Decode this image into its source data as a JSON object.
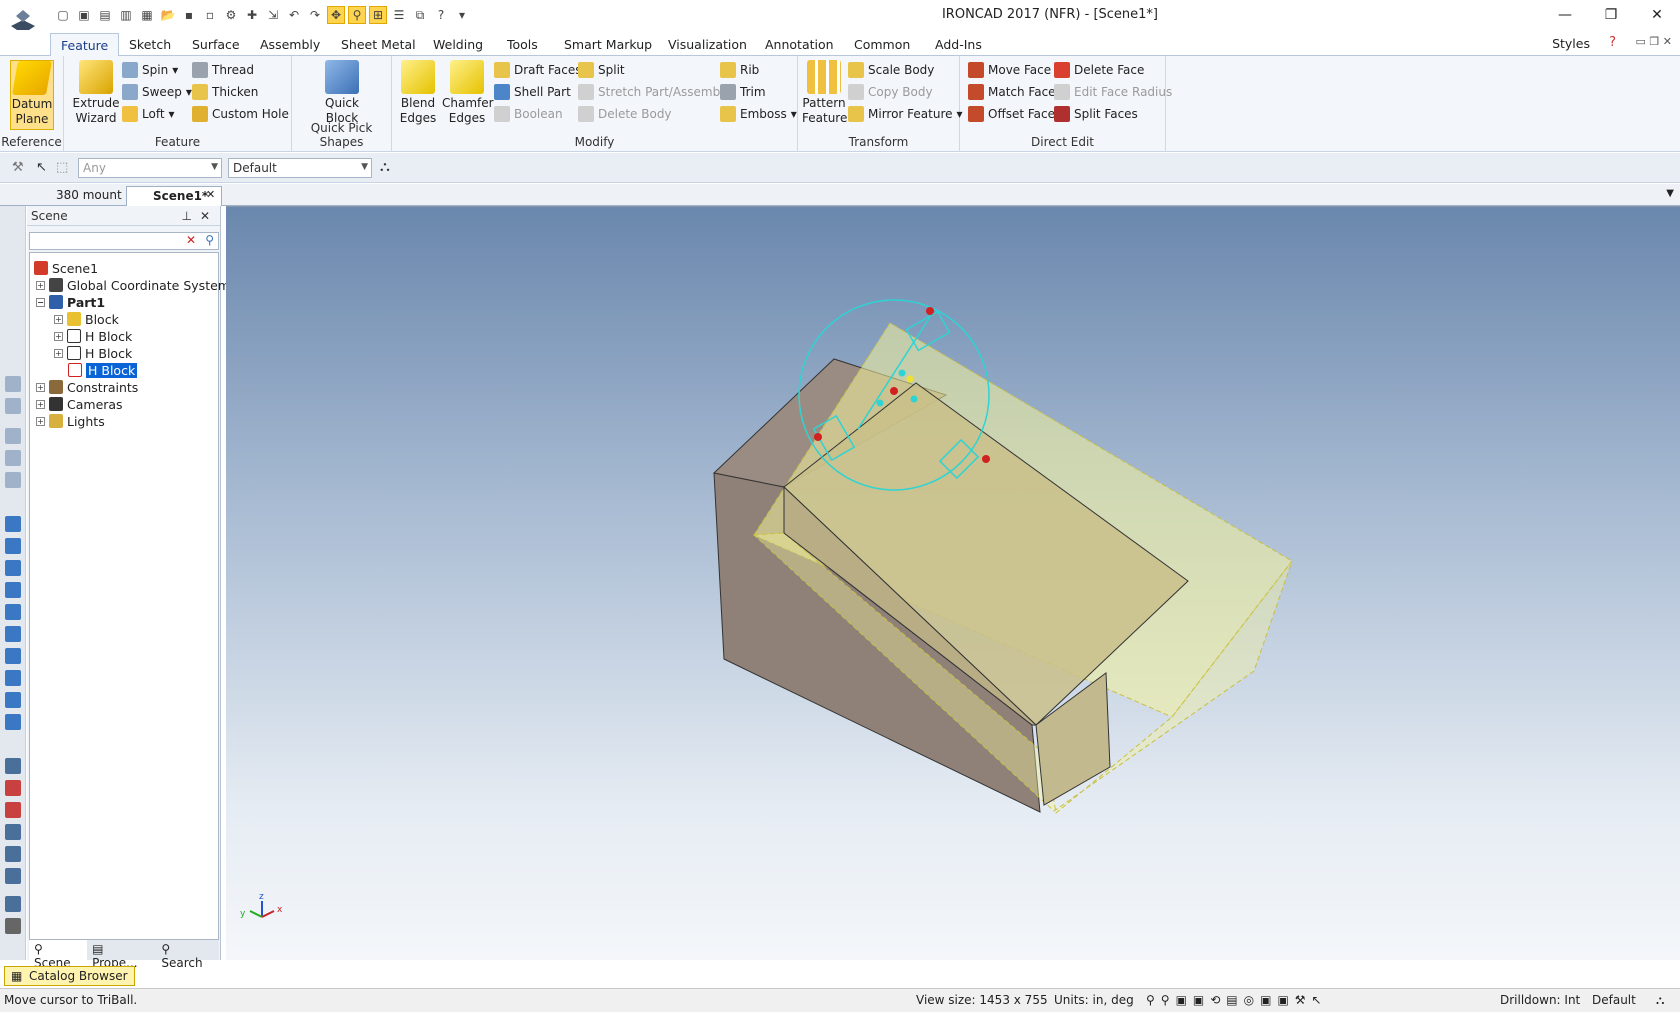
{
  "window": {
    "title": "IRONCAD 2017 (NFR) - [Scene1*]"
  },
  "menu_tabs": [
    "Feature",
    "Sketch",
    "Surface",
    "Assembly",
    "Sheet Metal",
    "Welding",
    "Tools",
    "Smart Markup",
    "Visualization",
    "Annotation",
    "Common",
    "Add-Ins"
  ],
  "styles_label": "Styles",
  "ribbon": {
    "reference": {
      "label": "Reference",
      "datum_plane": "Datum Plane"
    },
    "feature": {
      "label": "Feature",
      "extrude_wizard": "Extrude Wizard",
      "spin": "Spin",
      "sweep": "Sweep",
      "loft": "Loft",
      "thread": "Thread",
      "thicken": "Thicken",
      "custom_hole": "Custom Hole"
    },
    "quick_pick": {
      "label": "Quick Pick Shapes",
      "quick_block": "Quick Block"
    },
    "modify": {
      "label": "Modify",
      "blend_edges": "Blend Edges",
      "chamfer_edges": "Chamfer Edges",
      "draft_faces": "Draft Faces",
      "shell_part": "Shell Part",
      "boolean": "Boolean",
      "split": "Split",
      "stretch": "Stretch Part/Assembly",
      "delete_body": "Delete Body",
      "rib": "Rib",
      "trim": "Trim",
      "emboss": "Emboss"
    },
    "transform": {
      "label": "Transform",
      "pattern_feature": "Pattern Feature",
      "scale_body": "Scale Body",
      "copy_body": "Copy Body",
      "mirror_feature": "Mirror Feature"
    },
    "direct_edit": {
      "label": "Direct Edit",
      "move_face": "Move Face",
      "match_face": "Match Face",
      "offset_face": "Offset Face",
      "delete_face": "Delete Face",
      "edit_face_radius": "Edit Face Radius",
      "split_faces": "Split Faces"
    }
  },
  "toolbar2": {
    "filter_placeholder": "Any",
    "style_value": "Default"
  },
  "doc_tabs": [
    "380 mount",
    "Scene1*"
  ],
  "scene_panel": {
    "title": "Scene",
    "tree": [
      "Scene1",
      "Global Coordinate System",
      "Part1",
      "Block",
      "H Block",
      "H Block",
      "H Block",
      "Constraints",
      "Cameras",
      "Lights"
    ],
    "bottom_tabs": [
      "Scene",
      "Prope...",
      "Search"
    ]
  },
  "axes": {
    "x": "x",
    "y": "y",
    "z": "z"
  },
  "catalog_browser": "Catalog Browser",
  "status": {
    "message": "Move cursor to TriBall.",
    "view_size": "View size: 1453 x  755",
    "units": "Units: in, deg",
    "drilldown": "Drilldown: Int",
    "default": "Default"
  },
  "colors": {
    "accent": "#0a64d6",
    "highlight": "#ffd54f",
    "solid_face": "#8f8178",
    "ghost_face": "#f4f29b",
    "triball": "#2ed3d3"
  }
}
